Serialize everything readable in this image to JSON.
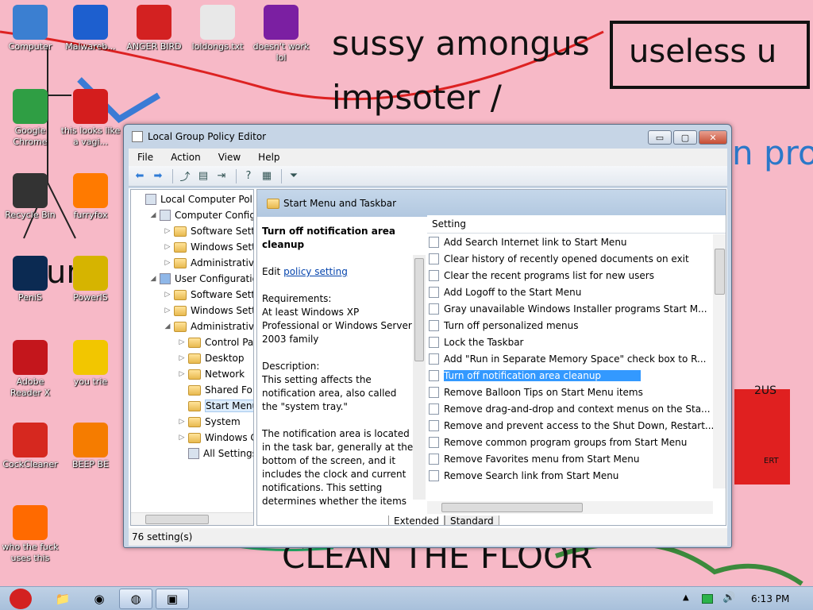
{
  "desktop": {
    "scribbles": [
      "sussy amongus",
      "useless u",
      "impsoter /",
      "CLEAN THE FLOOR",
      "n pro",
      "!!!",
      "um",
      "2US",
      "ERT"
    ],
    "icons": [
      {
        "label": "Computer",
        "icon": "computer-icon",
        "color": "#3b7fd1"
      },
      {
        "label": "Malwareb...",
        "icon": "malwarebytes-icon",
        "color": "#1d5fcf"
      },
      {
        "label": "ANGER BIRD",
        "icon": "angry-bird-icon",
        "color": "#d32121"
      },
      {
        "label": "loldongs.txt",
        "icon": "text-file-icon",
        "color": "#e8e8e8"
      },
      {
        "label": "doesn't work lol",
        "icon": "yahoo-messenger-icon",
        "color": "#7b1fa2"
      },
      {
        "label": "Google Chrome",
        "icon": "chrome-icon",
        "color": "#2f9e44"
      },
      {
        "label": "this looks like a vagi...",
        "icon": "opera-icon",
        "color": "#d41d1d"
      },
      {
        "label": "Recycle Bin",
        "icon": "recycle-bin-icon",
        "color": "#333333"
      },
      {
        "label": "furryfox",
        "icon": "firefox-icon",
        "color": "#ff7a00"
      },
      {
        "label": "PeniS",
        "icon": "photoshop-icon",
        "color": "#0b2a52"
      },
      {
        "label": "PowerIS",
        "icon": "disc-icon",
        "color": "#d6b400"
      },
      {
        "label": "Adobe Reader X",
        "icon": "adobe-reader-icon",
        "color": "#c4161c"
      },
      {
        "label": "you trie",
        "icon": "star-icon",
        "color": "#f2c600"
      },
      {
        "label": "CockCleaner",
        "icon": "ccleaner-icon",
        "color": "#d6281f"
      },
      {
        "label": "BEEP BE",
        "icon": "vlc-icon",
        "color": "#f57c00"
      },
      {
        "label": "who the fuck uses this",
        "icon": "winamp-icon",
        "color": "#ff6a00"
      }
    ]
  },
  "window": {
    "title": "Local Group Policy Editor",
    "controls": {
      "minimize": "▭",
      "maximize": "▢",
      "close": "✕"
    },
    "menu": [
      "File",
      "Action",
      "View",
      "Help"
    ],
    "toolbar": [
      {
        "icon": "back-arrow-icon",
        "glyph": "⬅"
      },
      {
        "icon": "forward-arrow-icon",
        "glyph": "➡"
      },
      {
        "icon": "up-folder-icon",
        "glyph": "⤴"
      },
      {
        "icon": "show-hide-tree-icon",
        "glyph": "▤"
      },
      {
        "icon": "export-list-icon",
        "glyph": "⇥"
      },
      {
        "icon": "help-icon",
        "glyph": "?"
      },
      {
        "icon": "properties-icon",
        "glyph": "▦"
      },
      {
        "icon": "filter-icon",
        "glyph": "⏷"
      }
    ],
    "tree": [
      {
        "label": "Local Computer Policy",
        "depth": 0,
        "arrow": "",
        "kind": "policy"
      },
      {
        "label": "Computer Configura",
        "depth": 1,
        "arrow": "◢",
        "kind": "computer"
      },
      {
        "label": "Software Setting",
        "depth": 2,
        "arrow": "▷",
        "kind": "folder"
      },
      {
        "label": "Windows Setting",
        "depth": 2,
        "arrow": "▷",
        "kind": "folder"
      },
      {
        "label": "Administrative Te",
        "depth": 2,
        "arrow": "▷",
        "kind": "folder"
      },
      {
        "label": "User Configuration",
        "depth": 1,
        "arrow": "◢",
        "kind": "user"
      },
      {
        "label": "Software Setting",
        "depth": 2,
        "arrow": "▷",
        "kind": "folder"
      },
      {
        "label": "Windows Setting",
        "depth": 2,
        "arrow": "▷",
        "kind": "folder"
      },
      {
        "label": "Administrative Te",
        "depth": 2,
        "arrow": "◢",
        "kind": "folder"
      },
      {
        "label": "Control Pane",
        "depth": 3,
        "arrow": "▷",
        "kind": "folder"
      },
      {
        "label": "Desktop",
        "depth": 3,
        "arrow": "▷",
        "kind": "folder"
      },
      {
        "label": "Network",
        "depth": 3,
        "arrow": "▷",
        "kind": "folder"
      },
      {
        "label": "Shared Folde",
        "depth": 3,
        "arrow": "",
        "kind": "folder"
      },
      {
        "label": "Start Menu ar",
        "depth": 3,
        "arrow": "",
        "kind": "folder",
        "selected": true
      },
      {
        "label": "System",
        "depth": 3,
        "arrow": "▷",
        "kind": "folder"
      },
      {
        "label": "Windows Co",
        "depth": 3,
        "arrow": "▷",
        "kind": "folder"
      },
      {
        "label": "All Settings",
        "depth": 3,
        "arrow": "",
        "kind": "settings"
      }
    ],
    "right_header": "Start Menu and Taskbar",
    "description": {
      "title": "Turn off notification area cleanup",
      "edit_prefix": "Edit",
      "edit_link": "policy setting",
      "requirements": "Requirements:\nAt least Windows XP Professional or Windows Server 2003 family",
      "description": "Description:\nThis setting affects the notification area, also called the \"system tray.\"",
      "body": "The notification area is located in the task bar, generally at the bottom of the screen, and it includes the clock and current notifications. This setting determines whether the items"
    },
    "list_header": "Setting",
    "settings": [
      "Add Search Internet link to Start Menu",
      "Clear history of recently opened documents on exit",
      "Clear the recent programs list for new users",
      "Add Logoff to the Start Menu",
      "Gray unavailable Windows Installer programs Start M...",
      "Turn off personalized menus",
      "Lock the Taskbar",
      "Add \"Run in Separate Memory Space\" check box to R...",
      "Turn off notification area cleanup",
      "Remove Balloon Tips on Start Menu items",
      "Remove drag-and-drop and context menus on the Sta...",
      "Remove and prevent access to the Shut Down, Restart...",
      "Remove common program groups from Start Menu",
      "Remove Favorites menu from Start Menu",
      "Remove Search link from Start Menu"
    ],
    "selected_setting": "Turn off notification area cleanup",
    "tabs": [
      "Extended",
      "Standard"
    ],
    "status": "76 setting(s)"
  },
  "taskbar": {
    "start_icon": "angry-bird-start-icon",
    "pinned": [
      {
        "icon": "explorer-icon",
        "glyph": "📁"
      },
      {
        "icon": "chrome-taskbar-icon",
        "glyph": "◉"
      },
      {
        "icon": "firefox-taskbar-icon",
        "glyph": "◍"
      },
      {
        "icon": "group-policy-taskbar-icon",
        "glyph": "▣"
      }
    ],
    "clock": "6:13 PM"
  }
}
